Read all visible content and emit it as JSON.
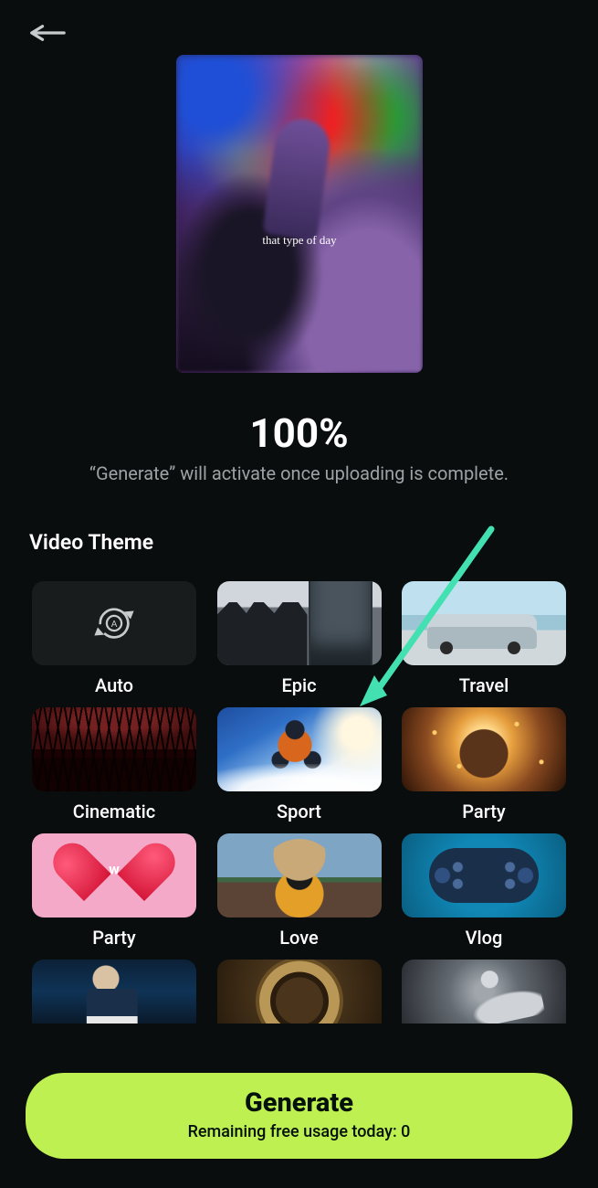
{
  "preview": {
    "caption": "that type of day"
  },
  "progress": {
    "percent_label": "100%",
    "message": "“Generate” will activate once uploading is complete."
  },
  "section": {
    "title": "Video Theme"
  },
  "themes": {
    "auto": {
      "label": "Auto",
      "selected": false
    },
    "epic": {
      "label": "Epic",
      "selected": false
    },
    "travel": {
      "label": "Travel",
      "selected": false
    },
    "cinematic": {
      "label": "Cinematic",
      "selected": false
    },
    "sport": {
      "label": "Sport",
      "selected": true
    },
    "party": {
      "label": "Party",
      "selected": false
    },
    "party2": {
      "label": "Party",
      "selected": false
    },
    "love": {
      "label": "Love",
      "selected": false
    },
    "vlog": {
      "label": "Vlog",
      "selected": false
    }
  },
  "generate": {
    "title": "Generate",
    "subtitle": "Remaining free usage today: 0"
  },
  "annotation": {
    "arrow_points_to": "sport"
  }
}
